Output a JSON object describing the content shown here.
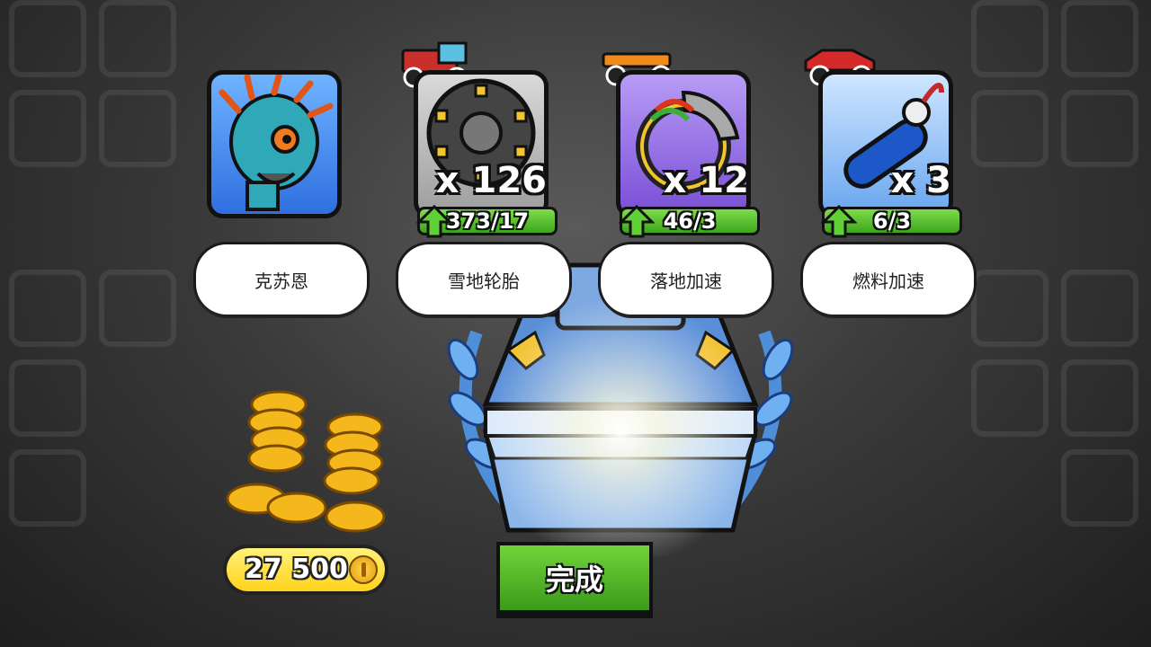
{
  "rewards": [
    {
      "name": "克苏恩",
      "count": "",
      "progress": "",
      "type": "character"
    },
    {
      "name": "雪地轮胎",
      "count": "x 126",
      "progress": "373/17",
      "type": "tires"
    },
    {
      "name": "落地加速",
      "count": "x 12",
      "progress": "46/3",
      "type": "landing-boost"
    },
    {
      "name": "燃料加速",
      "count": "x 3",
      "progress": "6/3",
      "type": "fuel-boost"
    }
  ],
  "coins": {
    "amount": "27 500"
  },
  "done_button": {
    "label": "完成"
  },
  "colors": {
    "accent_green": "#4caf25",
    "coin_yellow": "#ffd21a",
    "card_blue": "#2f6fe0",
    "card_purple": "#7a4fd6"
  },
  "icons": [
    "monster-portrait-icon",
    "snow-tire-icon",
    "landing-boost-icon",
    "nitro-tank-icon",
    "up-arrow-icon",
    "coin-icon",
    "treasure-chest-icon",
    "vehicle-icon"
  ]
}
